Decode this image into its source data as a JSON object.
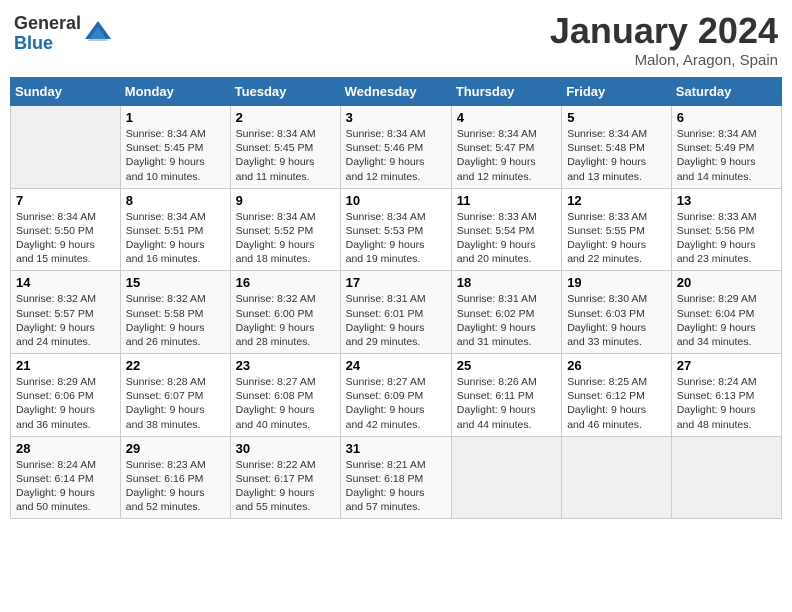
{
  "logo": {
    "general": "General",
    "blue": "Blue"
  },
  "title": {
    "month_year": "January 2024",
    "location": "Malon, Aragon, Spain"
  },
  "days_header": [
    "Sunday",
    "Monday",
    "Tuesday",
    "Wednesday",
    "Thursday",
    "Friday",
    "Saturday"
  ],
  "weeks": [
    [
      {
        "num": "",
        "info": ""
      },
      {
        "num": "1",
        "info": "Sunrise: 8:34 AM\nSunset: 5:45 PM\nDaylight: 9 hours\nand 10 minutes."
      },
      {
        "num": "2",
        "info": "Sunrise: 8:34 AM\nSunset: 5:45 PM\nDaylight: 9 hours\nand 11 minutes."
      },
      {
        "num": "3",
        "info": "Sunrise: 8:34 AM\nSunset: 5:46 PM\nDaylight: 9 hours\nand 12 minutes."
      },
      {
        "num": "4",
        "info": "Sunrise: 8:34 AM\nSunset: 5:47 PM\nDaylight: 9 hours\nand 12 minutes."
      },
      {
        "num": "5",
        "info": "Sunrise: 8:34 AM\nSunset: 5:48 PM\nDaylight: 9 hours\nand 13 minutes."
      },
      {
        "num": "6",
        "info": "Sunrise: 8:34 AM\nSunset: 5:49 PM\nDaylight: 9 hours\nand 14 minutes."
      }
    ],
    [
      {
        "num": "7",
        "info": "Sunrise: 8:34 AM\nSunset: 5:50 PM\nDaylight: 9 hours\nand 15 minutes."
      },
      {
        "num": "8",
        "info": "Sunrise: 8:34 AM\nSunset: 5:51 PM\nDaylight: 9 hours\nand 16 minutes."
      },
      {
        "num": "9",
        "info": "Sunrise: 8:34 AM\nSunset: 5:52 PM\nDaylight: 9 hours\nand 18 minutes."
      },
      {
        "num": "10",
        "info": "Sunrise: 8:34 AM\nSunset: 5:53 PM\nDaylight: 9 hours\nand 19 minutes."
      },
      {
        "num": "11",
        "info": "Sunrise: 8:33 AM\nSunset: 5:54 PM\nDaylight: 9 hours\nand 20 minutes."
      },
      {
        "num": "12",
        "info": "Sunrise: 8:33 AM\nSunset: 5:55 PM\nDaylight: 9 hours\nand 22 minutes."
      },
      {
        "num": "13",
        "info": "Sunrise: 8:33 AM\nSunset: 5:56 PM\nDaylight: 9 hours\nand 23 minutes."
      }
    ],
    [
      {
        "num": "14",
        "info": "Sunrise: 8:32 AM\nSunset: 5:57 PM\nDaylight: 9 hours\nand 24 minutes."
      },
      {
        "num": "15",
        "info": "Sunrise: 8:32 AM\nSunset: 5:58 PM\nDaylight: 9 hours\nand 26 minutes."
      },
      {
        "num": "16",
        "info": "Sunrise: 8:32 AM\nSunset: 6:00 PM\nDaylight: 9 hours\nand 28 minutes."
      },
      {
        "num": "17",
        "info": "Sunrise: 8:31 AM\nSunset: 6:01 PM\nDaylight: 9 hours\nand 29 minutes."
      },
      {
        "num": "18",
        "info": "Sunrise: 8:31 AM\nSunset: 6:02 PM\nDaylight: 9 hours\nand 31 minutes."
      },
      {
        "num": "19",
        "info": "Sunrise: 8:30 AM\nSunset: 6:03 PM\nDaylight: 9 hours\nand 33 minutes."
      },
      {
        "num": "20",
        "info": "Sunrise: 8:29 AM\nSunset: 6:04 PM\nDaylight: 9 hours\nand 34 minutes."
      }
    ],
    [
      {
        "num": "21",
        "info": "Sunrise: 8:29 AM\nSunset: 6:06 PM\nDaylight: 9 hours\nand 36 minutes."
      },
      {
        "num": "22",
        "info": "Sunrise: 8:28 AM\nSunset: 6:07 PM\nDaylight: 9 hours\nand 38 minutes."
      },
      {
        "num": "23",
        "info": "Sunrise: 8:27 AM\nSunset: 6:08 PM\nDaylight: 9 hours\nand 40 minutes."
      },
      {
        "num": "24",
        "info": "Sunrise: 8:27 AM\nSunset: 6:09 PM\nDaylight: 9 hours\nand 42 minutes."
      },
      {
        "num": "25",
        "info": "Sunrise: 8:26 AM\nSunset: 6:11 PM\nDaylight: 9 hours\nand 44 minutes."
      },
      {
        "num": "26",
        "info": "Sunrise: 8:25 AM\nSunset: 6:12 PM\nDaylight: 9 hours\nand 46 minutes."
      },
      {
        "num": "27",
        "info": "Sunrise: 8:24 AM\nSunset: 6:13 PM\nDaylight: 9 hours\nand 48 minutes."
      }
    ],
    [
      {
        "num": "28",
        "info": "Sunrise: 8:24 AM\nSunset: 6:14 PM\nDaylight: 9 hours\nand 50 minutes."
      },
      {
        "num": "29",
        "info": "Sunrise: 8:23 AM\nSunset: 6:16 PM\nDaylight: 9 hours\nand 52 minutes."
      },
      {
        "num": "30",
        "info": "Sunrise: 8:22 AM\nSunset: 6:17 PM\nDaylight: 9 hours\nand 55 minutes."
      },
      {
        "num": "31",
        "info": "Sunrise: 8:21 AM\nSunset: 6:18 PM\nDaylight: 9 hours\nand 57 minutes."
      },
      {
        "num": "",
        "info": ""
      },
      {
        "num": "",
        "info": ""
      },
      {
        "num": "",
        "info": ""
      }
    ]
  ]
}
